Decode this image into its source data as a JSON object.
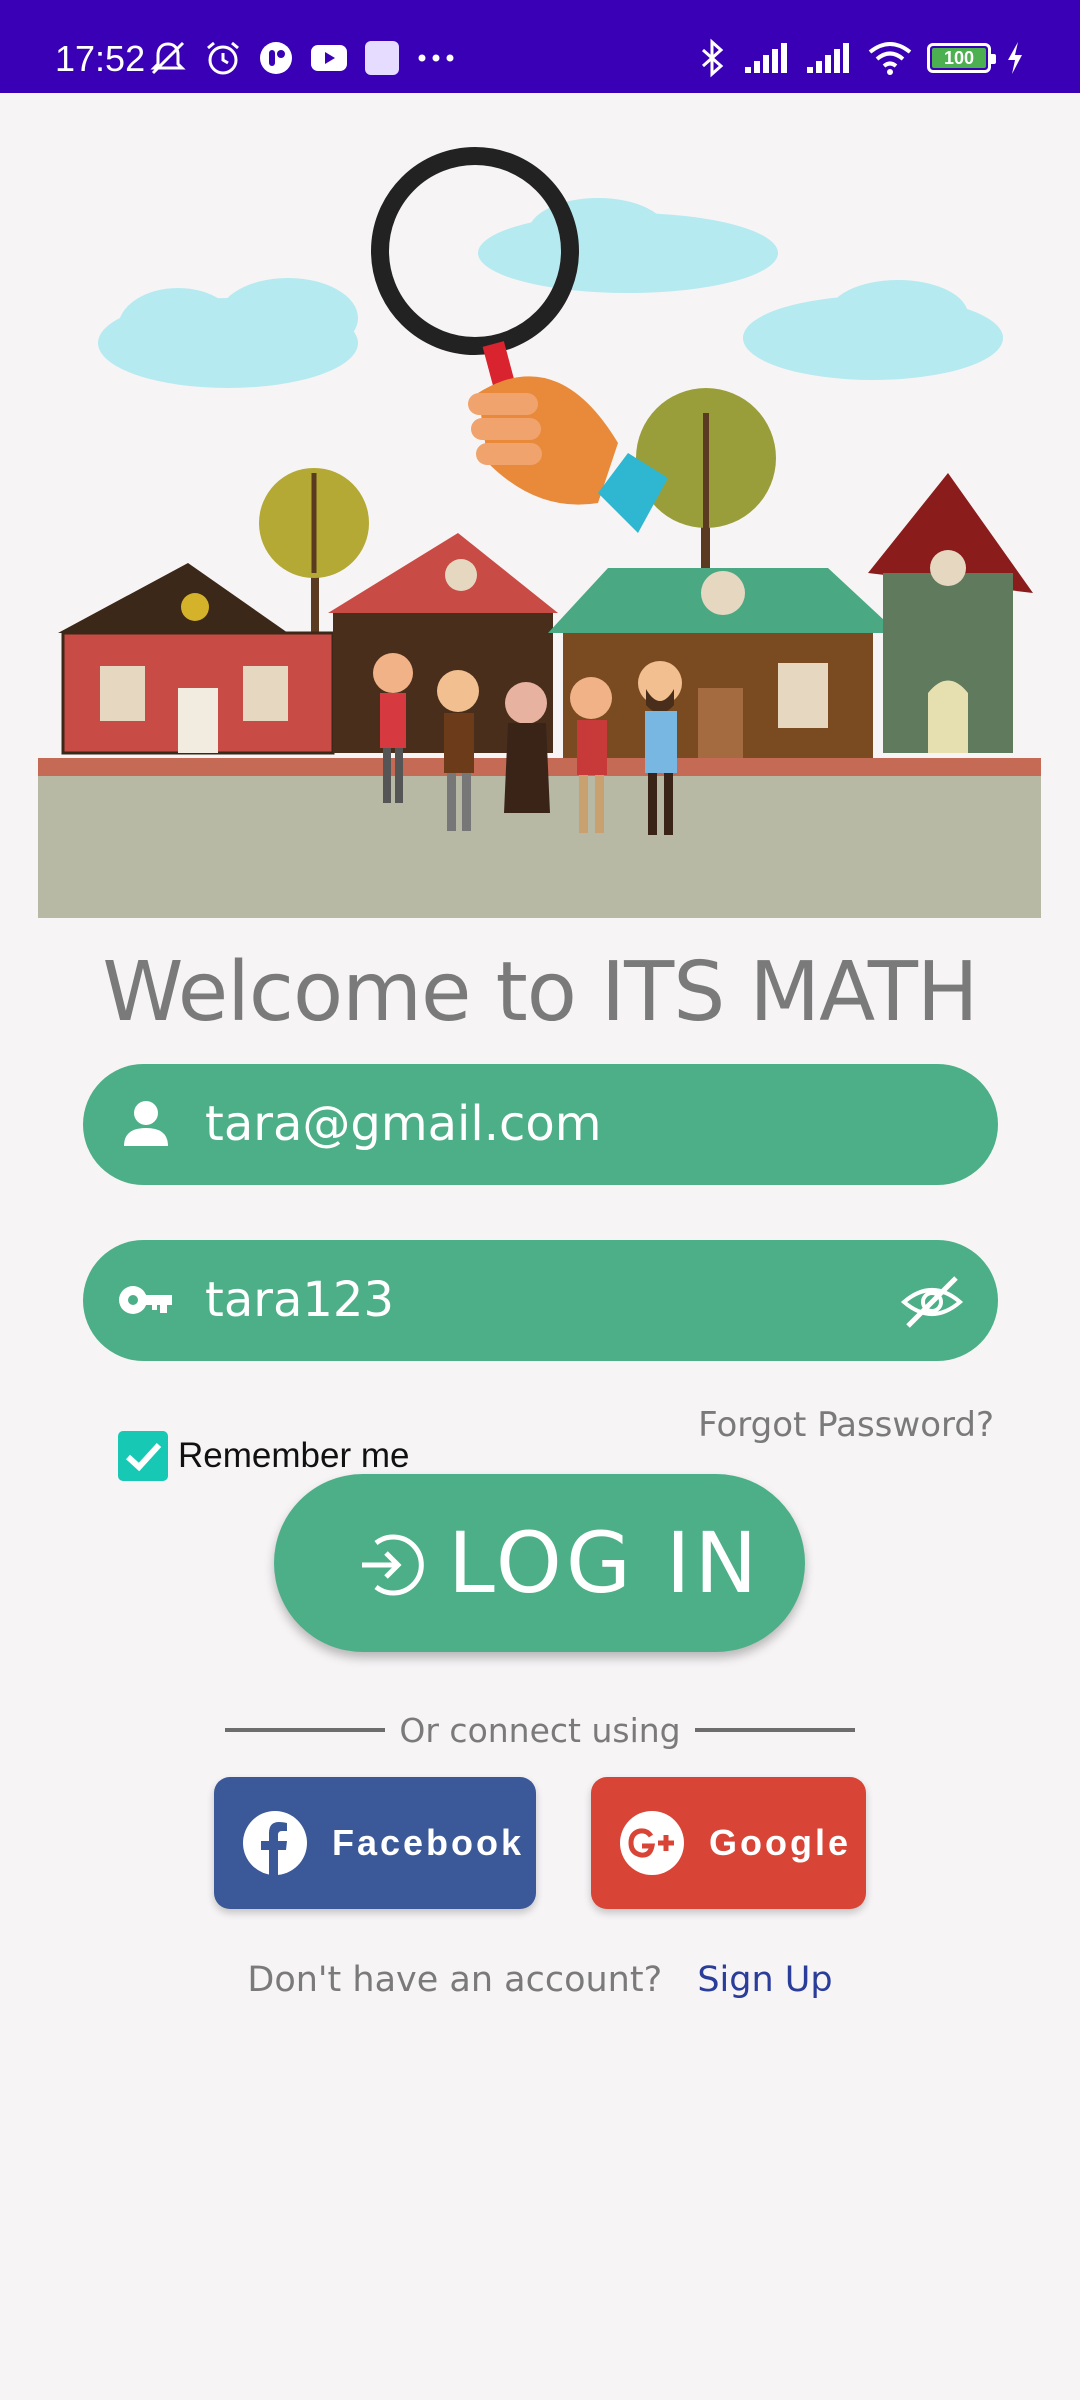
{
  "status_bar": {
    "time": "17:52",
    "battery": "100",
    "icons_left": [
      "muted-bell-icon",
      "alarm-icon",
      "app-icon",
      "youtube-icon",
      "square-app-icon",
      "more-icon"
    ],
    "icons_right": [
      "bluetooth-icon",
      "signal-icon",
      "signal-icon",
      "wifi-icon",
      "battery-icon",
      "charging-icon"
    ]
  },
  "title": "Welcome to ITS MATH",
  "email": {
    "value": "tara@gmail.com",
    "icon": "person-icon"
  },
  "password": {
    "value": "tara123",
    "icon": "key-icon",
    "toggle_icon": "eye-off-icon"
  },
  "remember": {
    "label": "Remember me",
    "checked": true
  },
  "forgot_label": "Forgot Password?",
  "login_label": "LOG IN",
  "divider_text": "Or connect using",
  "facebook_label": "Facebook",
  "google_label": "Google",
  "signup": {
    "question": "Don't have an account?",
    "link": "Sign Up"
  },
  "colors": {
    "status_bar": "#3a00b5",
    "accent_green": "#4caf87",
    "facebook": "#3b5998",
    "google": "#d84436",
    "checkbox": "#17c9b5",
    "link": "#2b3d9a"
  }
}
